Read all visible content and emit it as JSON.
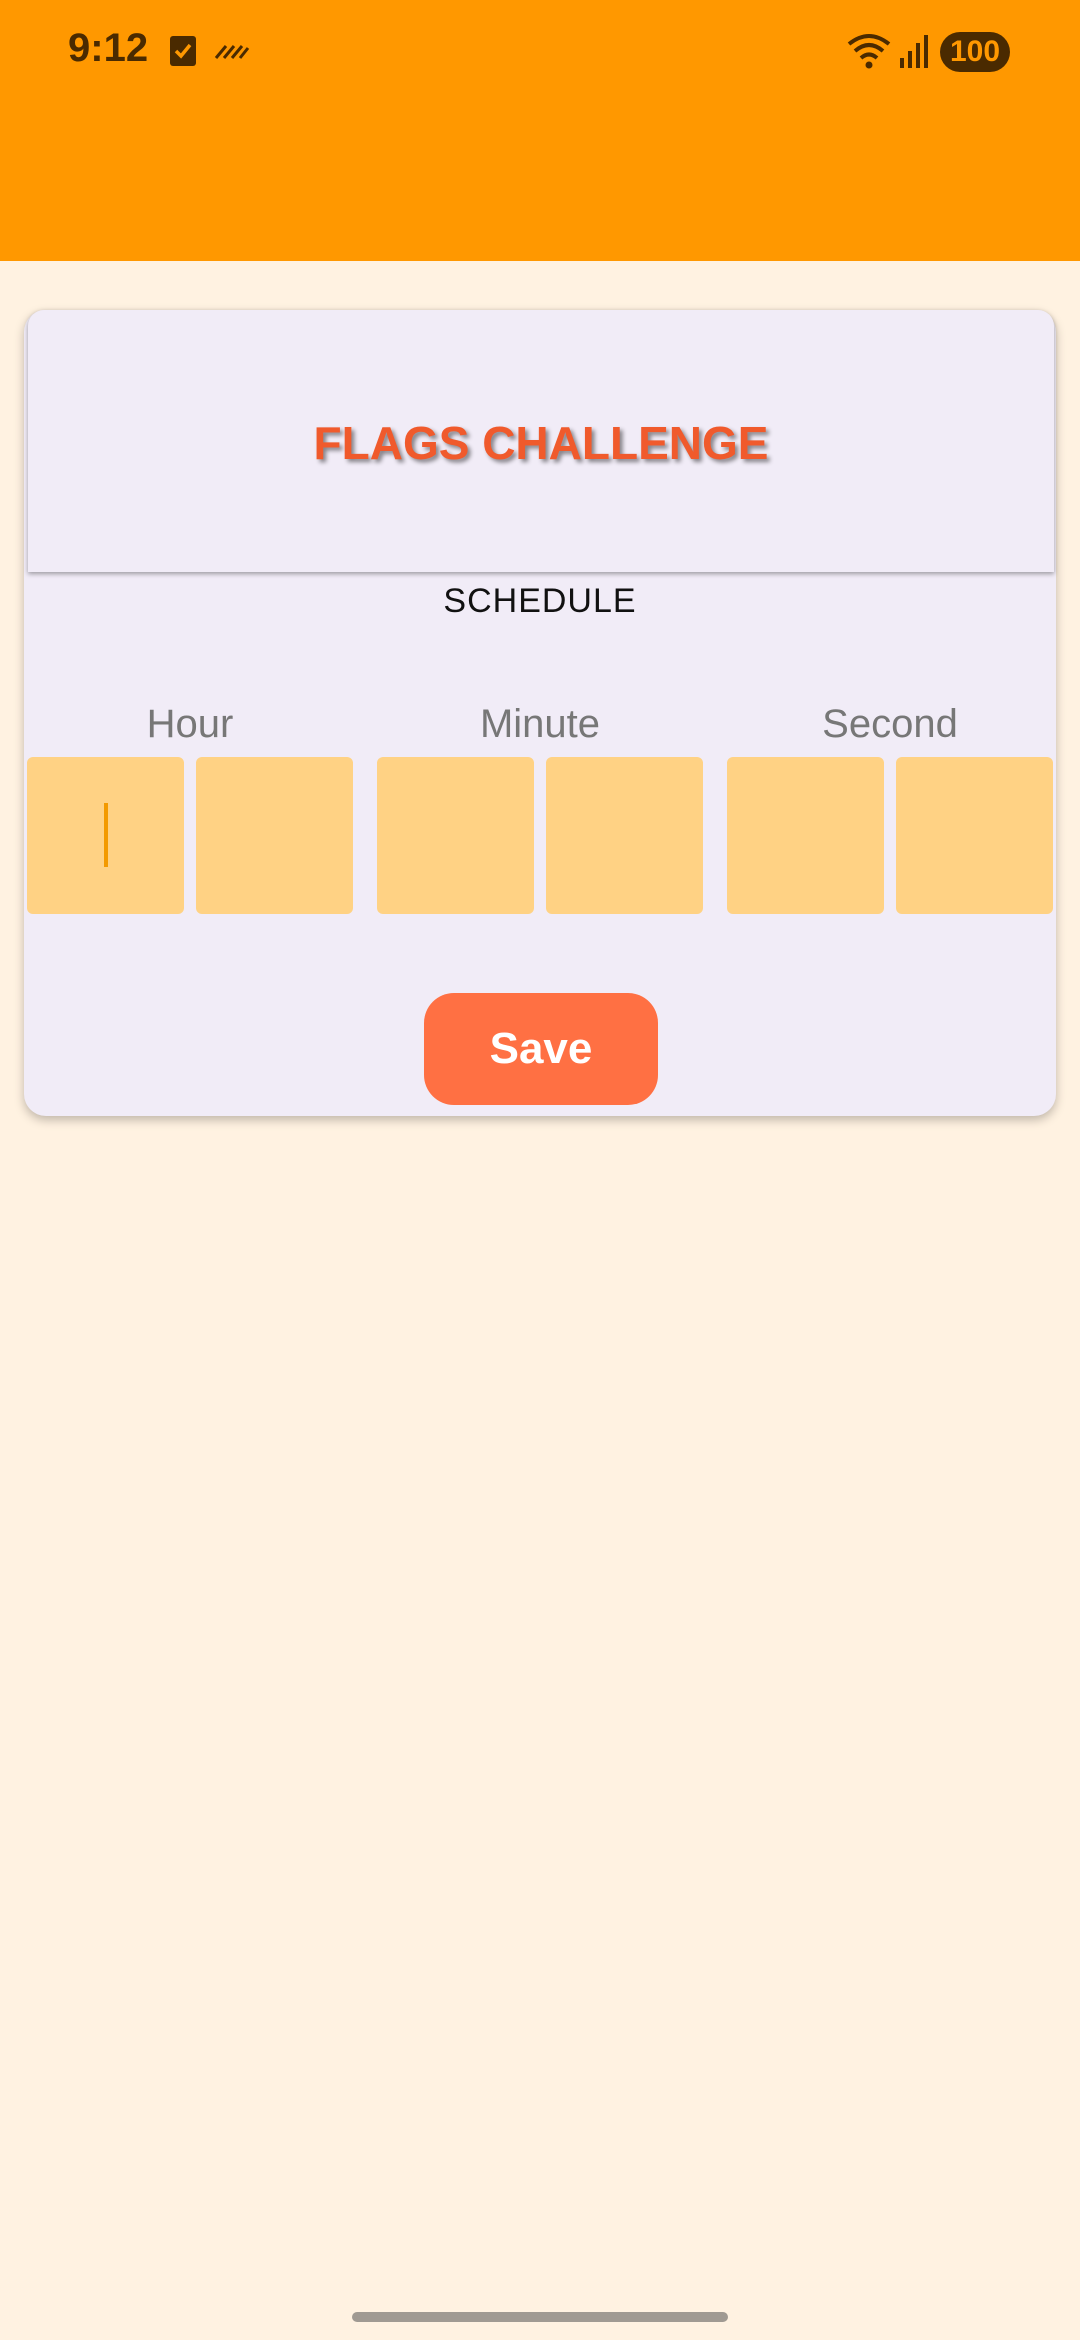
{
  "status_bar": {
    "time": "9:12",
    "icons": [
      "checkbox-icon",
      "wave-icon",
      "wifi-icon",
      "signal-icon"
    ],
    "battery": "100"
  },
  "colors": {
    "app_bar": "#FF9800",
    "background": "#FFF2E1",
    "card": "#F1ECF7",
    "title": "#F05A2C",
    "digit_box": "#FFD284",
    "save_button": "#FF7043"
  },
  "card": {
    "title": "FLAGS CHALLENGE",
    "subtitle": "SCHEDULE",
    "labels": {
      "hour": "Hour",
      "minute": "Minute",
      "second": "Second"
    },
    "save_label": "Save"
  }
}
